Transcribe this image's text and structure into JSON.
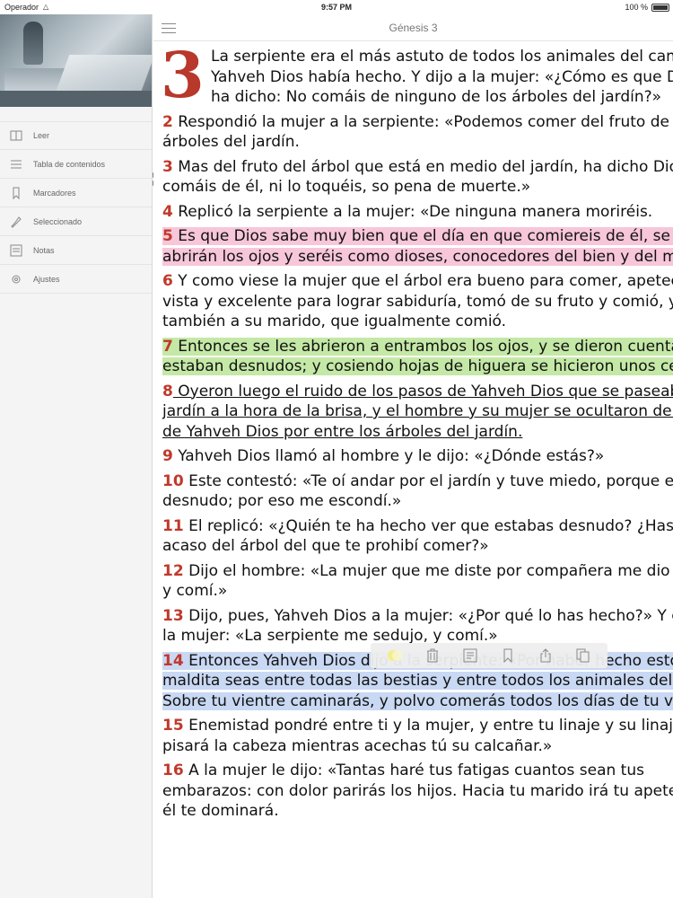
{
  "status": {
    "carrier": "Operador",
    "time": "9:57 PM",
    "battery": "100 %"
  },
  "sidebar": {
    "items": [
      {
        "label": "Leer",
        "icon": "read-icon"
      },
      {
        "label": "Tabla de contenidos",
        "icon": "list-icon"
      },
      {
        "label": "Marcadores",
        "icon": "bookmark-icon"
      },
      {
        "label": "Seleccionado",
        "icon": "highlighter-icon"
      },
      {
        "label": "Notas",
        "icon": "notes-icon"
      },
      {
        "label": "Ajustes",
        "icon": "gear-icon"
      }
    ]
  },
  "header": {
    "title": "Génesis 3"
  },
  "chapter": {
    "number": "3",
    "first_verse_lines": [
      "La serpiente era el más astuto de todos los animales del campo que",
      "Yahveh Dios había hecho. Y dijo a la mujer: «¿Cómo es que Dios os",
      "ha dicho: No comáis de ninguno de los árboles del jardín?»"
    ],
    "verses": [
      {
        "num": "2",
        "lines": [
          " Respondió la mujer a la serpiente: «Podemos comer del fruto de los",
          "árboles del jardín."
        ]
      },
      {
        "num": "3",
        "lines": [
          " Mas del fruto del árbol que está en medio del jardín, ha dicho Dios: No",
          "comáis de él, ni lo toquéis, so pena de muerte.»"
        ]
      },
      {
        "num": "4",
        "lines": [
          " Replicó la serpiente a la mujer: «De ninguna manera moriréis."
        ]
      },
      {
        "num": "5",
        "lines": [
          " Es que Dios sabe muy bien que el día en que comiereis de él, se os",
          "abrirán los ojos y seréis como dioses, conocedores del bien y del mal.»"
        ]
      },
      {
        "num": "6",
        "lines": [
          " Y como viese la mujer que el árbol era bueno para comer, apetecible a la",
          "vista y excelente para lograr sabiduría, tomó de su fruto y comió, y dio",
          "también a su marido, que igualmente comió."
        ]
      },
      {
        "num": "7",
        "lines": [
          " Entonces se les abrieron a entrambos los ojos, y se dieron cuenta de que",
          "estaban desnudos; y cosiendo hojas de higuera se hicieron unos ceñidores."
        ]
      },
      {
        "num": "8",
        "lines": [
          " Oyeron luego el ruido de los pasos de Yahveh Dios que se paseaba por el",
          "jardín a la hora de la brisa, y el hombre y su mujer se ocultaron de la vista",
          "de Yahveh Dios por entre los árboles del jardín."
        ]
      },
      {
        "num": "9",
        "lines": [
          " Yahveh Dios llamó al hombre y le dijo: «¿Dónde estás?»"
        ]
      },
      {
        "num": "10",
        "lines": [
          " Este contestó: «Te oí andar por el jardín y tuve miedo, porque estoy",
          "desnudo; por eso me escondí.»"
        ]
      },
      {
        "num": "11",
        "lines": [
          " El replicó: «¿Quién te ha hecho ver que estabas desnudo? ¿Has comido",
          "acaso del árbol del que te prohibí comer?»"
        ]
      },
      {
        "num": "12",
        "lines": [
          " Dijo el hombre: «La mujer que me diste por compañera me dio del árbol",
          "y comí.»"
        ]
      },
      {
        "num": "13",
        "lines": [
          " Dijo, pues, Yahveh Dios a la mujer: «¿Por qué lo has hecho?» Y contestó",
          "la mujer: «La serpiente me sedujo, y comí.»"
        ]
      },
      {
        "num": "14",
        "lines": [
          " Entonces Yahveh Dios dijo a la serpiente: «Por haber hecho esto,",
          "maldita seas entre todas las bestias y entre todos los animales del campo.",
          "Sobre tu vientre caminarás, y polvo comerás todos los días de tu vida."
        ]
      },
      {
        "num": "15",
        "lines": [
          " Enemistad pondré entre ti y la mujer, y entre tu linaje y su linaje: él te",
          "pisará la cabeza mientras acechas tú su calcañar.»"
        ]
      },
      {
        "num": "16",
        "lines": [
          " A la mujer le dijo: «Tantas haré tus fatigas cuantos sean tus",
          "embarazos: con dolor parirás los hijos. Hacia tu marido irá tu apetencia, y",
          "él te dominará."
        ]
      }
    ]
  },
  "toolbar": {
    "buttons": [
      {
        "name": "highlight-color-button",
        "icon": "color-dot-icon"
      },
      {
        "name": "delete-button",
        "icon": "trash-icon"
      },
      {
        "name": "note-button",
        "icon": "note-icon"
      },
      {
        "name": "bookmark-button",
        "icon": "bookmark-icon"
      },
      {
        "name": "share-button",
        "icon": "share-icon"
      },
      {
        "name": "copy-button",
        "icon": "copy-icon"
      }
    ]
  },
  "colors": {
    "verse_number": "#c0392b",
    "highlight_pink": "#f7c6d9",
    "highlight_green": "#c4e8a6",
    "highlight_blue": "#c9d8f3"
  }
}
